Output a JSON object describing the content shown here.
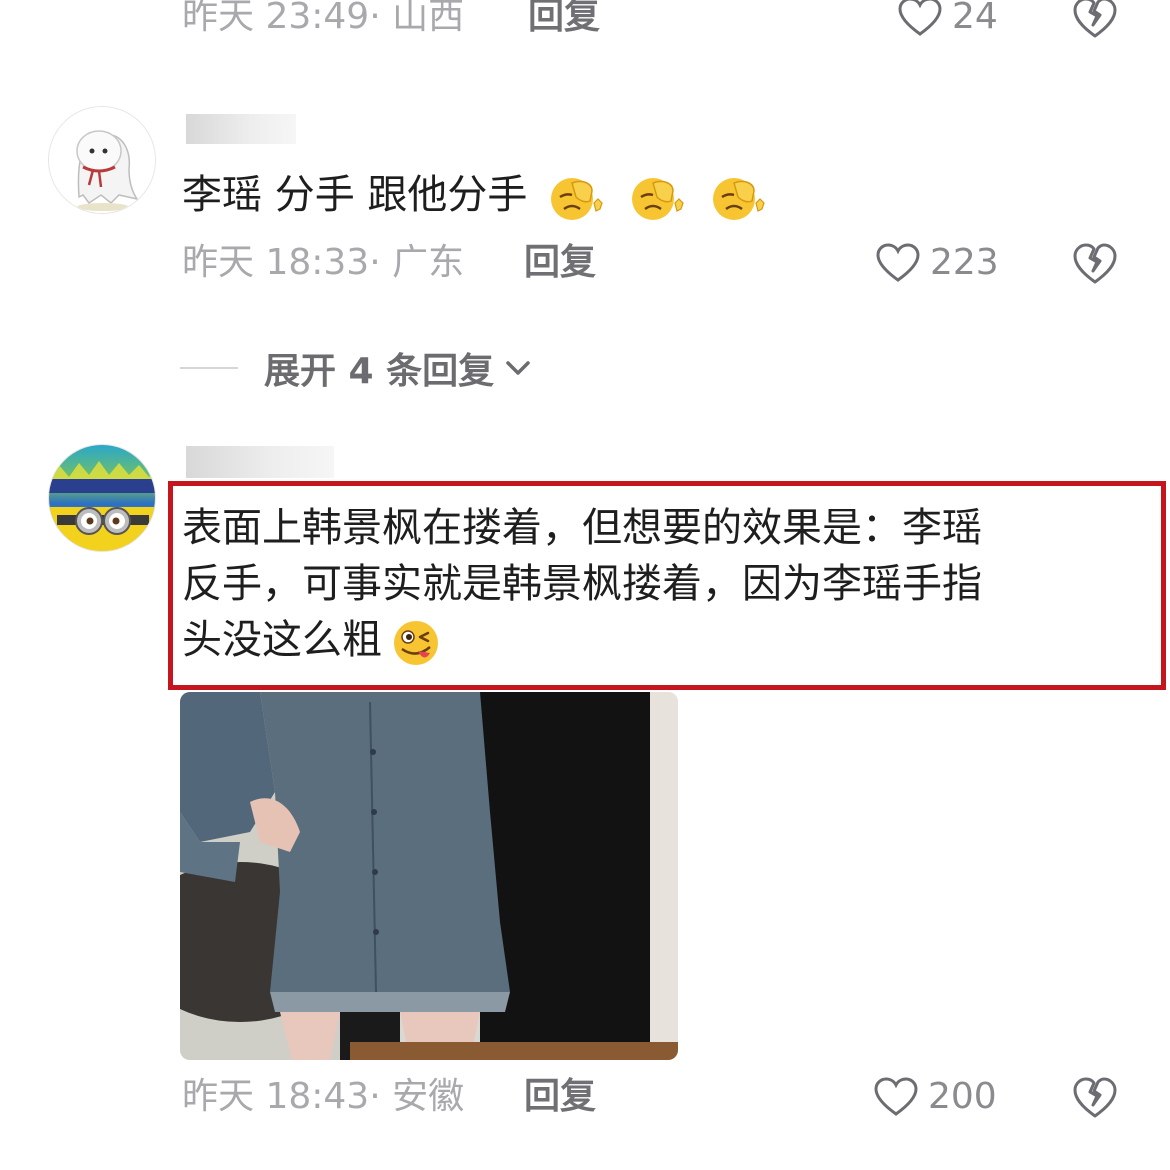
{
  "comments": [
    {
      "time_location": "昨天 23:49· 山西",
      "reply_label": "回复",
      "likes": "24"
    },
    {
      "text": "李瑶  分手  跟他分手",
      "emoji_icon": "facepalm-emoji-icon",
      "emoji_count": 3,
      "time_location": "昨天 18:33· 广东",
      "reply_label": "回复",
      "likes": "223"
    },
    {
      "lines": [
        "表面上韩景枫在搂着，但想要的效果是：李瑶",
        "反手，可事实就是韩景枫搂着，因为李瑶手指",
        "头没这么粗"
      ],
      "emoji_icon": "winking-tongue-emoji-icon",
      "time_location": "昨天 18:43· 安徽",
      "reply_label": "回复",
      "likes": "200"
    }
  ],
  "expand_replies": {
    "label": "展开 4 条回复"
  },
  "colors": {
    "highlight_border": "#c4161c",
    "meta_text": "#a8a8ad",
    "reply_text": "#6f6f74",
    "icon_stroke": "#6c6c72"
  }
}
